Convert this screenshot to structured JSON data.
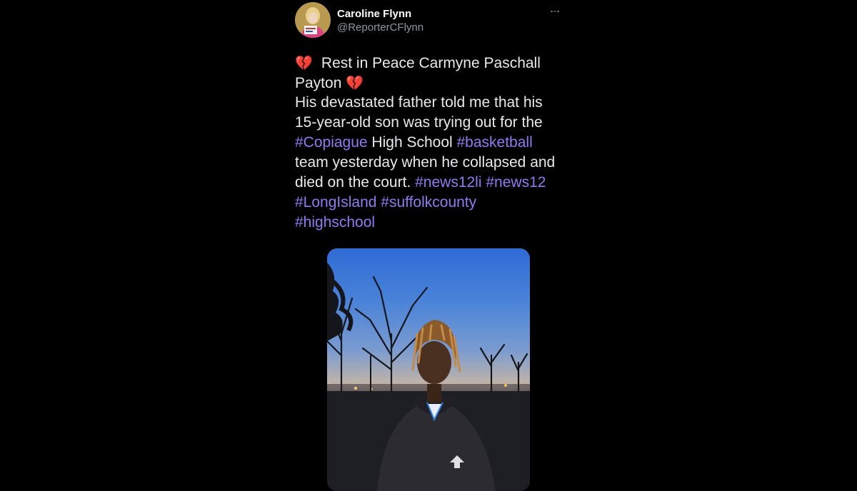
{
  "author": {
    "display_name": "Caroline Flynn",
    "handle": "@ReporterCFlynn"
  },
  "tweet": {
    "line1_emoji": "💔",
    "line1_text": "Rest in Peace Carmyne Paschall",
    "line2_text": "Payton",
    "line2_emoji": "💔",
    "line3_text": "His devastated father told me that his",
    "line4_text": "15-year-old son was trying out for the",
    "line5_tag1": "#Copiague",
    "line5_text": " High School ",
    "line5_tag2": "#basketball",
    "line6_text": "team yesterday when he collapsed and",
    "line7_text": "died on the court. ",
    "line7_tag1": "#news12li",
    "line7_tag2": "#news12",
    "line8_tag1": "#LongIsland",
    "line8_tag2": "#suffolkcounty",
    "line9_tag1": "#highschool"
  },
  "colors": {
    "background": "#000000",
    "text": "#e7e9ea",
    "handle": "#8b98a5",
    "hashtag": "#8e7cf0"
  },
  "icons": {
    "more": "more-options-icon",
    "emoji": "broken-heart-emoji"
  }
}
